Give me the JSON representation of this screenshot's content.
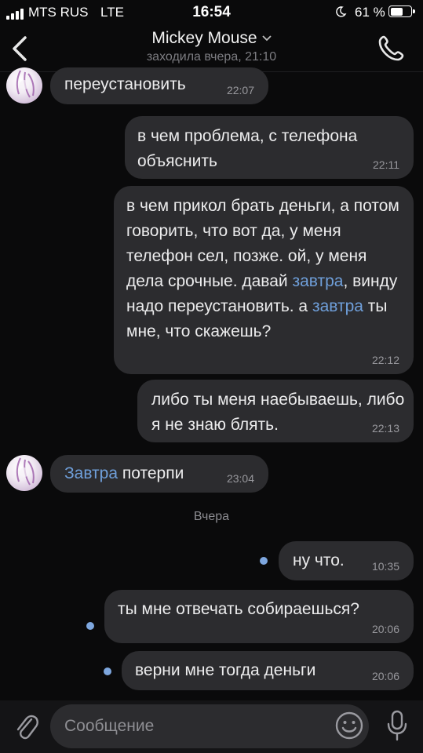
{
  "status_bar": {
    "carrier": "MTS RUS",
    "network": "LTE",
    "time": "16:54",
    "battery": "61 %",
    "battery_level": 0.61
  },
  "header": {
    "back_icon": "chevron-left-icon",
    "contact_name": "Mickey Mouse",
    "last_seen": "заходила вчера, 21:10",
    "call_icon": "phone-icon"
  },
  "messages": [
    {
      "side": "incoming",
      "text": "переустановить",
      "time": "22:07"
    },
    {
      "side": "outgoing",
      "text": "в чем проблема, с телефона объяснить",
      "time": "22:11"
    },
    {
      "side": "outgoing",
      "parts": [
        "в чем прикол брать деньги, а потом говорить, что вот да, у меня телефон сел, позже. ой, у меня дела срочные. давай ",
        "завтра",
        ", винду надо переустановить. а ",
        "завтра",
        " ты мне, что скажешь?"
      ],
      "time": "22:12"
    },
    {
      "side": "outgoing",
      "text": "либо ты меня наебываешь, либо я не знаю блять.",
      "time": "22:13"
    },
    {
      "side": "incoming",
      "parts": [
        "Завтра",
        " потерпи"
      ],
      "time": "23:04"
    },
    {
      "side": "outgoing",
      "text": "ну что.",
      "time": "10:35",
      "unread": true
    },
    {
      "side": "outgoing",
      "text": "ты мне отвечать собираешься?",
      "time": "20:06",
      "unread": true
    },
    {
      "side": "outgoing",
      "text": "верни мне тогда деньги",
      "time": "20:06",
      "unread": true
    }
  ],
  "day_separator": "Вчера",
  "composer": {
    "attach_icon": "paperclip-icon",
    "placeholder": "Сообщение",
    "emoji_icon": "smile-icon",
    "mic_icon": "microphone-icon"
  },
  "colors": {
    "background": "#0a0a0b",
    "bubble": "#2c2c2f",
    "link": "#6f9fda",
    "unread_dot": "#7ea7df"
  }
}
